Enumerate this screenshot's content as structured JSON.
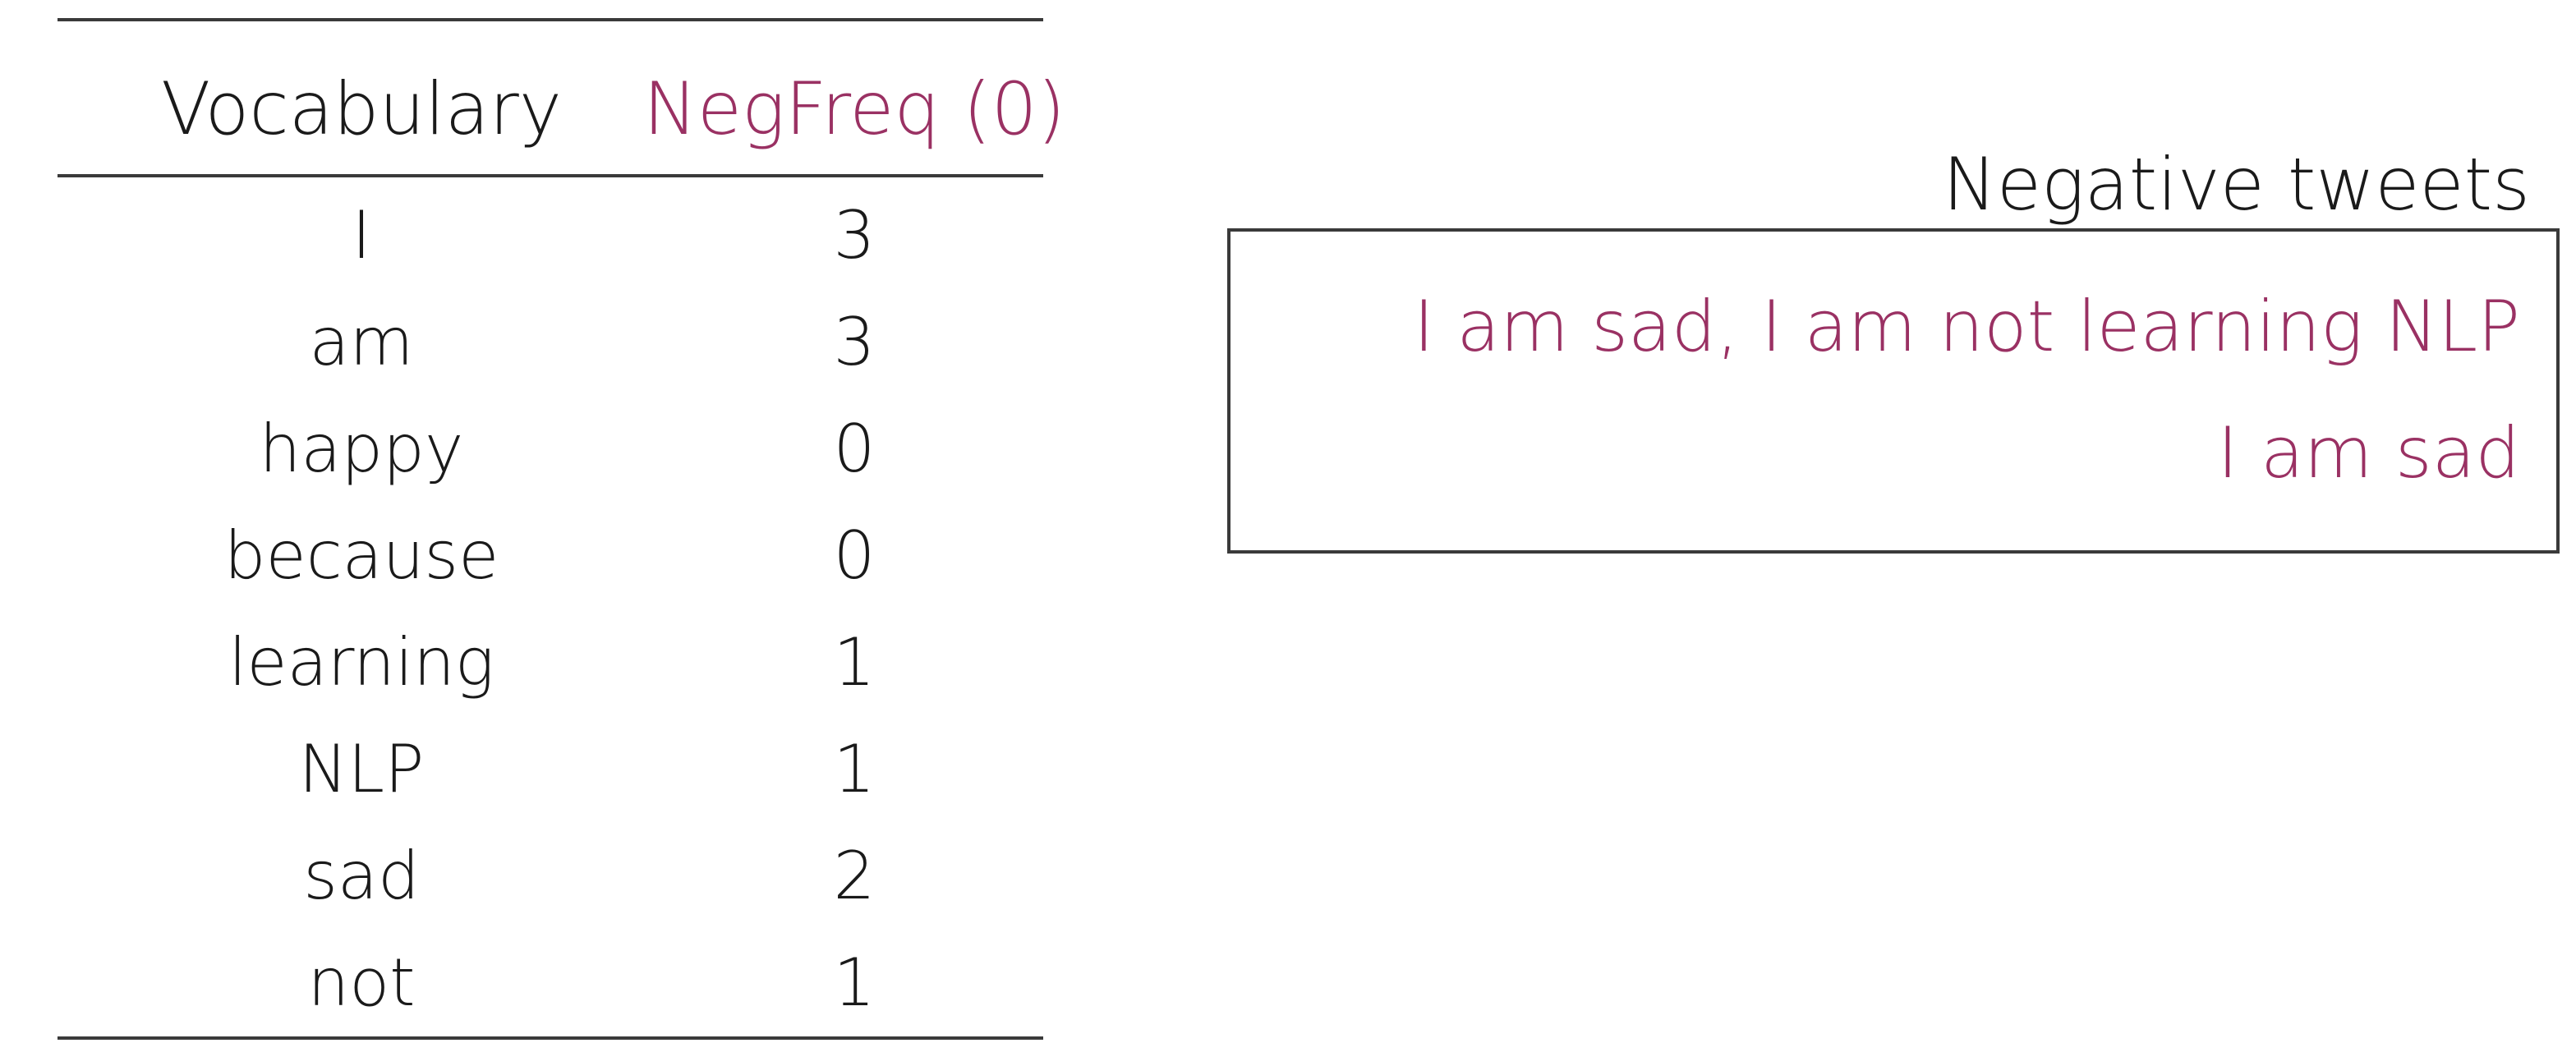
{
  "table": {
    "headers": {
      "vocabulary": "Vocabulary",
      "neg_freq": "NegFreq (0)"
    },
    "rows": [
      {
        "word": "I",
        "freq": "3"
      },
      {
        "word": "am",
        "freq": "3"
      },
      {
        "word": "happy",
        "freq": "0"
      },
      {
        "word": "because",
        "freq": "0"
      },
      {
        "word": "learning",
        "freq": "1"
      },
      {
        "word": "NLP",
        "freq": "1"
      },
      {
        "word": "sad",
        "freq": "2"
      },
      {
        "word": "not",
        "freq": "1"
      }
    ]
  },
  "tweets": {
    "label": "Negative tweets",
    "items": [
      "I am sad, I am not learning NLP",
      "I am sad"
    ]
  },
  "colors": {
    "accent": "#9a3163",
    "text": "#1a1a1a",
    "rule": "#3a3a3a"
  }
}
